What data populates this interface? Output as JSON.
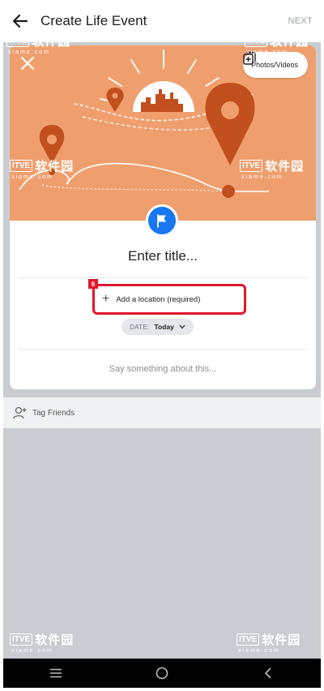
{
  "header": {
    "title": "Create Life Event",
    "next_label": "NEXT",
    "back_icon": "arrow-left-icon"
  },
  "card": {
    "close_icon": "close-icon",
    "photos_videos_label": "Photos/Videos",
    "photos_icon": "photo-add-icon",
    "flag_icon": "flag-icon",
    "title_placeholder": "Enter title...",
    "step_number": "6",
    "add_location_label": "Add a location (required)",
    "date_label": "DATE:",
    "date_value": "Today",
    "description_placeholder": "Say something about this..."
  },
  "tag_friends": {
    "label": "Tag Friends",
    "icon": "person-add-icon"
  },
  "watermark": {
    "logo": "ITVE",
    "brand": "软件园",
    "domain": "xiame.com"
  },
  "colors": {
    "accent": "#1877f2",
    "banner": "#ef9f6e",
    "highlight": "#e0182c",
    "background": "#c9ccd1"
  }
}
